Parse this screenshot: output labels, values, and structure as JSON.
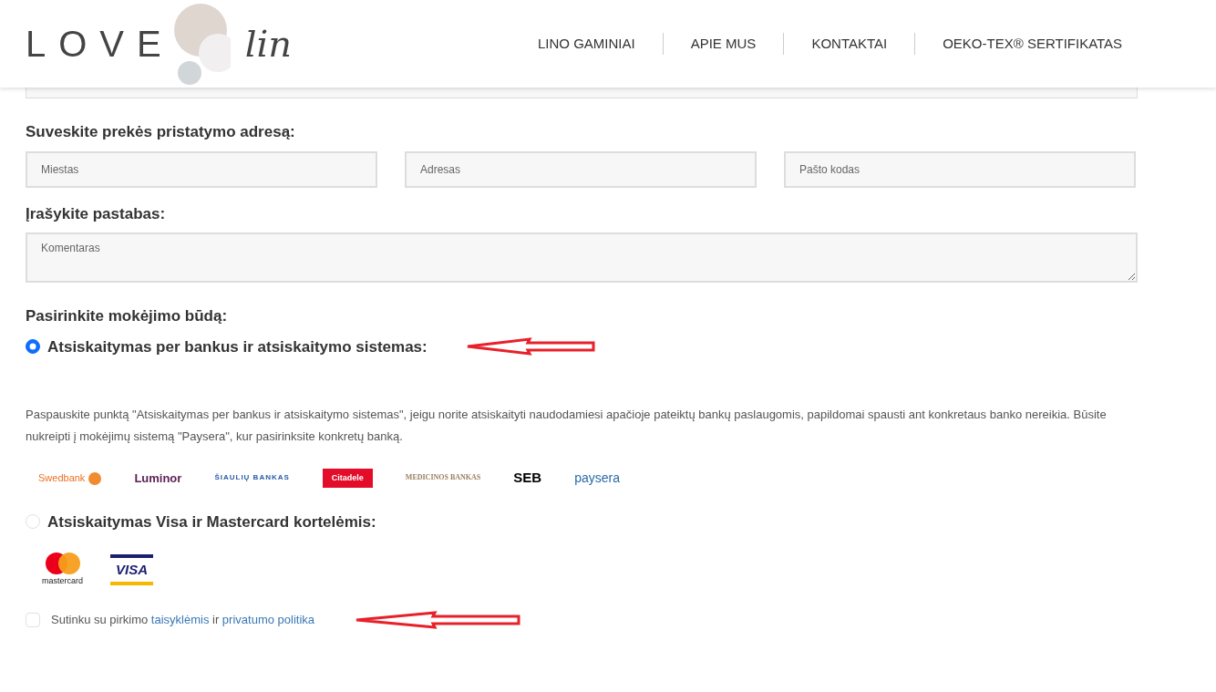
{
  "header": {
    "logo": {
      "word": "LOVE",
      "script": "lin"
    },
    "nav": [
      {
        "label": "LINO GAMINIAI"
      },
      {
        "label": "APIE MUS"
      },
      {
        "label": "KONTAKTAI"
      },
      {
        "label": "OEKO-TEX® SERTIFIKATAS"
      }
    ]
  },
  "address": {
    "heading": "Suveskite prekės pristatymo adresą:",
    "fields": [
      {
        "placeholder": "Miestas"
      },
      {
        "placeholder": "Adresas"
      },
      {
        "placeholder": "Pašto kodas"
      }
    ]
  },
  "notes": {
    "heading": "Įrašykite pastabas:",
    "placeholder": "Komentaras"
  },
  "payment": {
    "heading": "Pasirinkite mokėjimo būdą:",
    "methods": [
      {
        "label": "Atsiskaitymas per bankus ir atsiskaitymo sistemas:",
        "selected": true,
        "description": "Paspauskite punktą \"Atsiskaitymas per bankus ir atsiskaitymo sistemas\", jeigu norite atsiskaityti naudodamiesi apačioje pateiktų bankų paslaugomis, papildomai spausti ant konkretaus banko nereikia. Būsite nukreipti į mokėjimų sistemą \"Paysera\", kur pasirinksite konkretų banką.",
        "logos": [
          {
            "kind": "swedbank",
            "text": "Swedbank"
          },
          {
            "kind": "luminor",
            "text": "Luminor"
          },
          {
            "kind": "siauliu",
            "text": "ŠIAULIŲ BANKAS"
          },
          {
            "kind": "citadele",
            "text": "Citadele"
          },
          {
            "kind": "medicinos",
            "text": "MEDICINOS BANKAS"
          },
          {
            "kind": "seb",
            "text": "SEB"
          },
          {
            "kind": "paysera",
            "text": "paysera"
          }
        ]
      },
      {
        "label": "Atsiskaitymas Visa ir Mastercard kortelėmis:",
        "selected": false,
        "logos": [
          {
            "kind": "mastercard",
            "text": "mastercard"
          },
          {
            "kind": "visa",
            "text": "VISA"
          }
        ]
      }
    ]
  },
  "agree": {
    "checked": false,
    "before": "Sutinku su pirkimo",
    "link1": "taisyklėmis",
    "middle": "ir",
    "link2": "privatumo politika"
  }
}
